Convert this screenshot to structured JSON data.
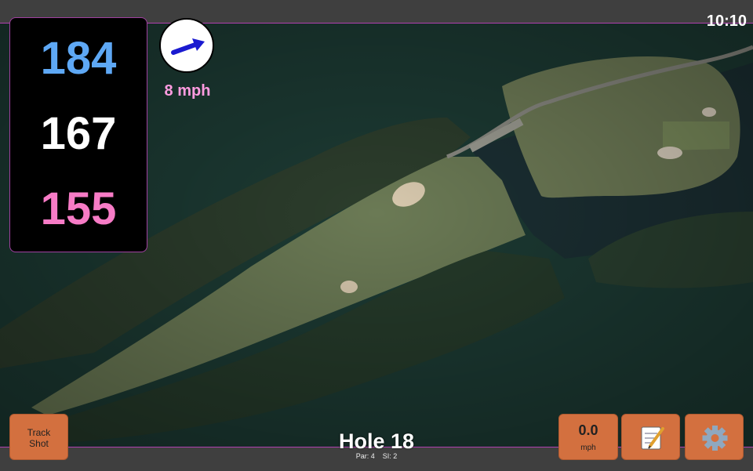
{
  "status_bar": {
    "time": "10:10"
  },
  "distances": {
    "back": "184",
    "middle": "167",
    "front": "155"
  },
  "wind": {
    "speed": "8 mph",
    "direction_icon": "wind-arrow-icon"
  },
  "hole": {
    "title": "Hole 18",
    "par": "Par: 4",
    "stroke_index": "SI: 2"
  },
  "buttons": {
    "track_shot_line1": "Track",
    "track_shot_line2": "Shot",
    "speed_value": "0.0",
    "speed_unit": "mph",
    "notes_icon": "notepad-icon",
    "settings_icon": "gear-icon"
  },
  "colors": {
    "back": "#5ea8f5",
    "middle": "#ffffff",
    "front": "#f77bc6",
    "wind_text": "#ff9be0",
    "button": "#d3703f",
    "accent_border": "#b040b0"
  }
}
